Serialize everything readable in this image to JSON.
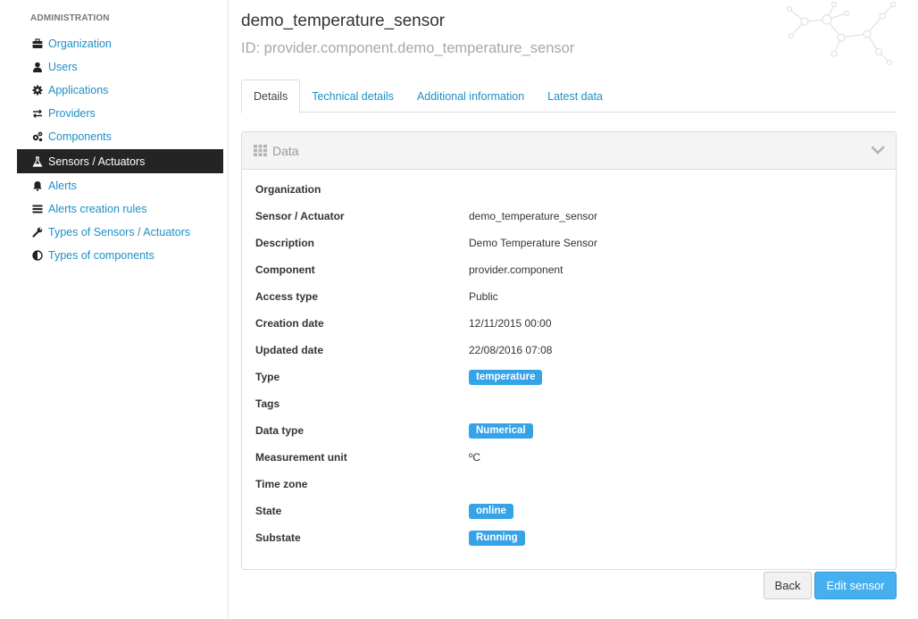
{
  "sidebar": {
    "heading": "ADMINISTRATION",
    "items": [
      {
        "label": "Organization",
        "icon": "briefcase-icon"
      },
      {
        "label": "Users",
        "icon": "user-icon"
      },
      {
        "label": "Applications",
        "icon": "gear-icon"
      },
      {
        "label": "Providers",
        "icon": "exchange-icon"
      },
      {
        "label": "Components",
        "icon": "gears-icon"
      },
      {
        "label": "Sensors / Actuators",
        "icon": "flask-icon",
        "active": true
      },
      {
        "label": "Alerts",
        "icon": "bell-icon"
      },
      {
        "label": "Alerts creation rules",
        "icon": "list-icon"
      },
      {
        "label": "Types of Sensors / Actuators",
        "icon": "wrench-icon"
      },
      {
        "label": "Types of components",
        "icon": "half-circle-icon"
      }
    ]
  },
  "header": {
    "title": "demo_temperature_sensor",
    "subtitle": "ID: provider.component.demo_temperature_sensor"
  },
  "tabs": [
    {
      "label": "Details",
      "active": true
    },
    {
      "label": "Technical details"
    },
    {
      "label": "Additional information"
    },
    {
      "label": "Latest data"
    }
  ],
  "panel": {
    "title": "Data",
    "rows": [
      {
        "label": "Organization",
        "value": ""
      },
      {
        "label": "Sensor / Actuator",
        "value": "demo_temperature_sensor"
      },
      {
        "label": "Description",
        "value": "Demo Temperature Sensor"
      },
      {
        "label": "Component",
        "value": "provider.component"
      },
      {
        "label": "Access type",
        "value": "Public"
      },
      {
        "label": "Creation date",
        "value": "12/11/2015 00:00"
      },
      {
        "label": "Updated date",
        "value": "22/08/2016 07:08"
      },
      {
        "label": "Type",
        "value": "temperature",
        "badge": true
      },
      {
        "label": "Tags",
        "value": ""
      },
      {
        "label": "Data type",
        "value": "Numerical",
        "badge": true
      },
      {
        "label": "Measurement unit",
        "value": "ºC"
      },
      {
        "label": "Time zone",
        "value": ""
      },
      {
        "label": "State",
        "value": "online",
        "badge": true
      },
      {
        "label": "Substate",
        "value": "Running",
        "badge": true
      }
    ]
  },
  "actions": {
    "back_label": "Back",
    "edit_label": "Edit sensor"
  },
  "colors": {
    "link": "#1d8fc6",
    "active_nav_bg": "#242424",
    "badge": "#35a3e8",
    "primary_button": "#45aff0"
  }
}
